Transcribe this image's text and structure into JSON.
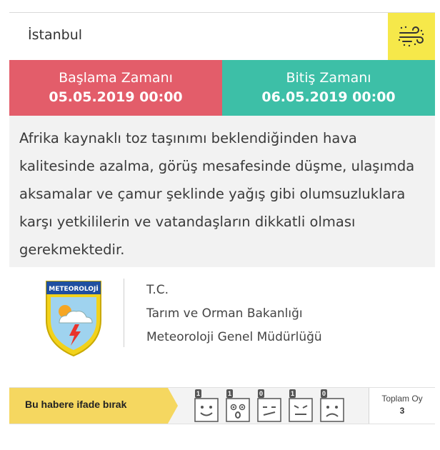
{
  "header": {
    "city": "İstanbul",
    "weather_icon": "dust-wind-icon",
    "badge_color": "#f6e84a"
  },
  "times": {
    "start_label": "Başlama Zamanı",
    "start_value": "05.05.2019 00:00",
    "end_label": "Bitiş Zamanı",
    "end_value": "06.05.2019 00:00",
    "start_color": "#e35d6a",
    "end_color": "#3dbfa7"
  },
  "description": "Afrika kaynaklı toz taşınımı beklendiğinden hava kalitesinde azalma, görüş mesafesinde düşme, ulaşımda aksamalar ve çamur şeklinde yağış gibi olumsuzluklara karşı yetkililerin ve vatandaşların dikkatli olması gerekmektedir.",
  "org": {
    "logo_text": "METEOROLOJİ",
    "line1": "T.C.",
    "line2": "Tarım ve Orman Bakanlığı",
    "line3": "Meteoroloji Genel Müdürlüğü"
  },
  "reactions": {
    "label": "Bu habere ifade bırak",
    "faces": [
      {
        "icon": "happy-face-icon",
        "count": "1"
      },
      {
        "icon": "surprised-face-icon",
        "count": "1"
      },
      {
        "icon": "confused-face-icon",
        "count": "0"
      },
      {
        "icon": "annoyed-face-icon",
        "count": "1"
      },
      {
        "icon": "sad-face-icon",
        "count": "0"
      }
    ],
    "total_label": "Toplam Oy",
    "total_value": "3"
  }
}
